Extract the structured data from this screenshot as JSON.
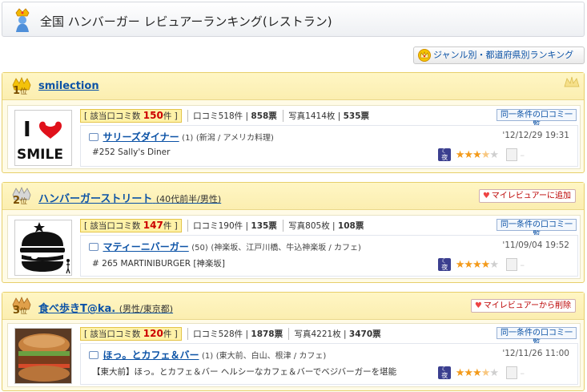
{
  "header": {
    "title": "全国 ハンバーガー レビュアーランキング(レストラン)"
  },
  "genre_button": {
    "label": "ジャンル別・都道府県別ランキング"
  },
  "cards": [
    {
      "rank": "1",
      "rank_suffix": "位",
      "reviewer": "smilection",
      "reviewer_info": "",
      "my_button": "",
      "stats": {
        "hit_label": "該当口コミ数",
        "hit_count": "150",
        "hit_unit": "件",
        "kuchikomi": "口コミ518件",
        "kuchikomi_votes": "858票",
        "photos": "写真1414枚",
        "photo_votes": "535票"
      },
      "same_cond": "同一条件の口コミ一覧",
      "restaurant": {
        "name": "サリーズダイナー",
        "count": "(1)",
        "meta": "(新潟 / アメリカ料理)",
        "date": "'12/12/29 19:31",
        "desc": "#252 Sally's Diner"
      },
      "rating": {
        "time": "夜",
        "stars": 3.5
      },
      "thumb_text": [
        "I",
        "SMILE"
      ]
    },
    {
      "rank": "2",
      "rank_suffix": "位",
      "reviewer": "ハンバーガーストリート",
      "reviewer_info": "(40代前半/男性)",
      "my_button": "マイレビュアーに追加",
      "stats": {
        "hit_label": "該当口コミ数",
        "hit_count": "147",
        "hit_unit": "件",
        "kuchikomi": "口コミ190件",
        "kuchikomi_votes": "135票",
        "photos": "写真805枚",
        "photo_votes": "108票"
      },
      "same_cond": "同一条件の口コミ一覧",
      "restaurant": {
        "name": "マティーニバーガー",
        "count": "(50)",
        "meta": "(神楽坂、江戸川橋、牛込神楽坂 / カフェ)",
        "date": "'11/09/04 19:52",
        "desc": "# 265 MARTINIBURGER [神楽坂]"
      },
      "rating": {
        "time": "夜",
        "stars": 4
      }
    },
    {
      "rank": "3",
      "rank_suffix": "位",
      "reviewer": "食べ歩きT@ka.",
      "reviewer_info": "(男性/東京都)",
      "my_button": "マイレビュアーから削除",
      "stats": {
        "hit_label": "該当口コミ数",
        "hit_count": "120",
        "hit_unit": "件",
        "kuchikomi": "口コミ528件",
        "kuchikomi_votes": "1878票",
        "photos": "写真4221枚",
        "photo_votes": "3470票"
      },
      "same_cond": "同一条件の口コミ一覧",
      "restaurant": {
        "name": "ほっ。とカフェ＆バー",
        "count": "(1)",
        "meta": "(東大前、白山、根津 / カフェ)",
        "date": "'12/11/26 11:00",
        "desc": "【東大前】ほっ。とカフェ＆バー ヘルシーなカフェ＆バーでベジバーガーを堪能"
      },
      "rating": {
        "time": "夜",
        "stars": 3.5
      }
    }
  ],
  "colors": {
    "link": "#0b52a6",
    "hit_count": "#cc0000",
    "star": "#f39a1a",
    "card_border": "#e7cf6b"
  }
}
